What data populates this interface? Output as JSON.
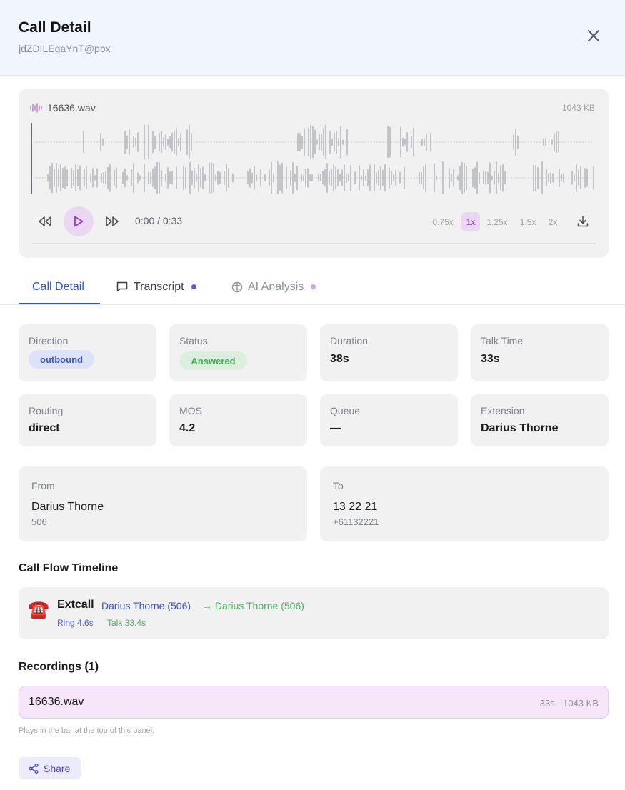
{
  "header": {
    "title": "Call Detail",
    "subtitle": "jdZDILEgaYnT@pbx"
  },
  "player": {
    "file_name": "16636.wav",
    "file_size": "1043 KB",
    "time": "0:00 / 0:33",
    "progress": 0,
    "speeds": [
      "0.75x",
      "1x",
      "1.25x",
      "1.5x",
      "2x"
    ],
    "active_speed": "1x",
    "accent_color": "#9a37c8"
  },
  "tabs": [
    {
      "label": "Call Detail",
      "active": true
    },
    {
      "label": "Transcript",
      "dot_color": "#5b5bd6"
    },
    {
      "label": "AI Analysis",
      "dot_color": "#d8a2ec"
    }
  ],
  "details": {
    "direction": {
      "label": "Direction",
      "value": "outbound"
    },
    "status": {
      "label": "Status",
      "value": "Answered"
    },
    "duration": {
      "label": "Duration",
      "value": "38s"
    },
    "talk_time": {
      "label": "Talk Time",
      "value": "33s"
    },
    "routing": {
      "label": "Routing",
      "value": "direct"
    },
    "mos": {
      "label": "MOS",
      "value": "4.2"
    },
    "queue": {
      "label": "Queue",
      "value": "—"
    },
    "extension": {
      "label": "Extension",
      "value": "Darius Thorne"
    }
  },
  "from": {
    "label": "From",
    "name": "Darius Thorne",
    "number": "506"
  },
  "to": {
    "label": "To",
    "name": "13 22 21",
    "number": "+61132221"
  },
  "timeline": {
    "title": "Call Flow Timeline",
    "icon": "telephone-icon",
    "event": "Extcall",
    "from": "Darius Thorne (506)",
    "to": "→ Darius Thorne (506)",
    "ring": "Ring 4.6s",
    "talk": "Talk 33.4s"
  },
  "recordings": {
    "title": "Recordings (1)",
    "items": [
      {
        "name": "16636.wav",
        "meta": "33s · 1043 KB"
      }
    ],
    "hint": "Plays in the bar at the top of this panel."
  },
  "share": {
    "label": "Share"
  }
}
